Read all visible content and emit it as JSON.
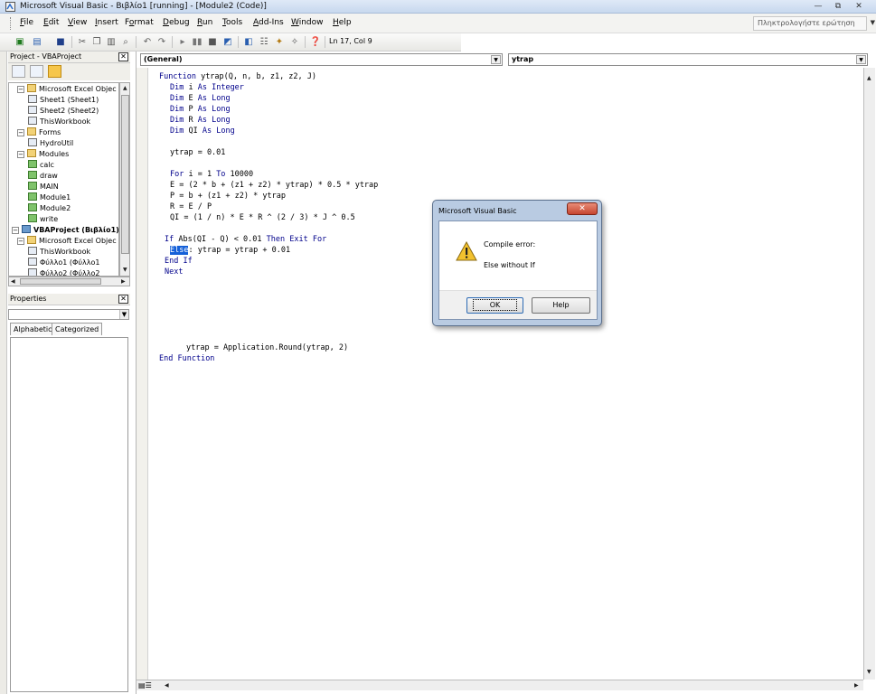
{
  "window": {
    "title": "Microsoft Visual Basic - Βιβλίο1 [running] - [Module2 (Code)]",
    "minimize_label": "—",
    "restore_label": "⧉",
    "close_label": "✕"
  },
  "menubar": {
    "items": [
      {
        "label": "File"
      },
      {
        "label": "Edit"
      },
      {
        "label": "View"
      },
      {
        "label": "Insert"
      },
      {
        "label": "Format"
      },
      {
        "label": "Debug"
      },
      {
        "label": "Run"
      },
      {
        "label": "Tools"
      },
      {
        "label": "Add-Ins"
      },
      {
        "label": "Window"
      },
      {
        "label": "Help"
      }
    ],
    "ask_placeholder": "Πληκτρολογήστε ερώτηση"
  },
  "toolbar": {
    "status": "Ln 17, Col 9",
    "icons": [
      "excel-view-icon",
      "insert-module-icon",
      "save-icon",
      "cut-icon",
      "copy-icon",
      "paste-icon",
      "find-icon",
      "undo-icon",
      "redo-icon",
      "run-icon",
      "break-icon",
      "reset-icon",
      "design-mode-icon",
      "project-explorer-icon",
      "properties-icon",
      "object-browser-icon",
      "toolbox-icon",
      "help-icon"
    ]
  },
  "project_pane": {
    "title": "Project - VBAProject",
    "tree": [
      {
        "label": "Microsoft Excel Objec",
        "indent": 1,
        "type": "folder",
        "expander": "−"
      },
      {
        "label": "Sheet1 (Sheet1)",
        "indent": 3,
        "type": "sheet"
      },
      {
        "label": "Sheet2 (Sheet2)",
        "indent": 3,
        "type": "sheet"
      },
      {
        "label": "ThisWorkbook",
        "indent": 3,
        "type": "workbook"
      },
      {
        "label": "Forms",
        "indent": 1,
        "type": "folder",
        "expander": "−"
      },
      {
        "label": "HydroUtil",
        "indent": 3,
        "type": "form"
      },
      {
        "label": "Modules",
        "indent": 1,
        "type": "folder",
        "expander": "−"
      },
      {
        "label": "calc",
        "indent": 3,
        "type": "module"
      },
      {
        "label": "draw",
        "indent": 3,
        "type": "module"
      },
      {
        "label": "MAIN",
        "indent": 3,
        "type": "module"
      },
      {
        "label": "Module1",
        "indent": 3,
        "type": "module"
      },
      {
        "label": "Module2",
        "indent": 3,
        "type": "module"
      },
      {
        "label": "write",
        "indent": 3,
        "type": "module"
      },
      {
        "label": "VBAProject (Βιβλίο1)",
        "indent": 0,
        "type": "project",
        "expander": "−",
        "bold": true
      },
      {
        "label": "Microsoft Excel Objec",
        "indent": 1,
        "type": "folder",
        "expander": "−"
      },
      {
        "label": "ThisWorkbook",
        "indent": 3,
        "type": "workbook"
      },
      {
        "label": "Φύλλο1 (Φύλλο1",
        "indent": 3,
        "type": "sheet"
      },
      {
        "label": "Φύλλο2 (Φύλλο2",
        "indent": 3,
        "type": "sheet"
      }
    ]
  },
  "properties_pane": {
    "title": "Properties",
    "tab_alphabetic": "Alphabetic",
    "tab_categorized": "Categorized"
  },
  "code_window": {
    "object_combo": "(General)",
    "proc_combo": "ytrap",
    "lines": [
      {
        "text": "Function ytrap(Q, n, b, z1, z2, J)",
        "indent": 0
      },
      {
        "text": "Dim i As Integer",
        "indent": 2
      },
      {
        "text": "Dim E As Long",
        "indent": 2
      },
      {
        "text": "Dim P As Long",
        "indent": 2
      },
      {
        "text": "Dim R As Long",
        "indent": 2
      },
      {
        "text": "Dim QI As Long",
        "indent": 2
      },
      {
        "text": "",
        "indent": 0
      },
      {
        "text": "ytrap = 0.01",
        "indent": 2
      },
      {
        "text": "",
        "indent": 0
      },
      {
        "text": "For i = 1 To 10000",
        "indent": 2
      },
      {
        "text": "E = (2 * b + (z1 + z2) * ytrap) * 0.5 * ytrap",
        "indent": 2
      },
      {
        "text": "P = b + (z1 + z2) * ytrap",
        "indent": 2
      },
      {
        "text": "R = E / P",
        "indent": 2
      },
      {
        "text": "QI = (1 / n) * E * R ^ (2 / 3) * J ^ 0.5",
        "indent": 2
      },
      {
        "text": "",
        "indent": 0
      },
      {
        "text": "If Abs(QI - Q) < 0.01 Then Exit For",
        "indent": 1
      },
      {
        "text": ": ytrap = ytrap + 0.01",
        "indent": 2,
        "selected": "Else"
      },
      {
        "text": "End If",
        "indent": 1
      },
      {
        "text": "Next",
        "indent": 1
      },
      {
        "text": "",
        "indent": 0
      },
      {
        "text": "",
        "indent": 0
      },
      {
        "text": "",
        "indent": 0
      },
      {
        "text": "",
        "indent": 0
      },
      {
        "text": "",
        "indent": 0
      },
      {
        "text": "",
        "indent": 0
      },
      {
        "text": "ytrap = Application.Round(ytrap, 2)",
        "indent": 5
      },
      {
        "text": "End Function",
        "indent": 0
      }
    ]
  },
  "dialog": {
    "title": "Microsoft Visual Basic",
    "close_label": "✕",
    "message_title": "Compile error:",
    "message_body": "Else without If",
    "ok_label": "OK",
    "help_label": "Help"
  }
}
